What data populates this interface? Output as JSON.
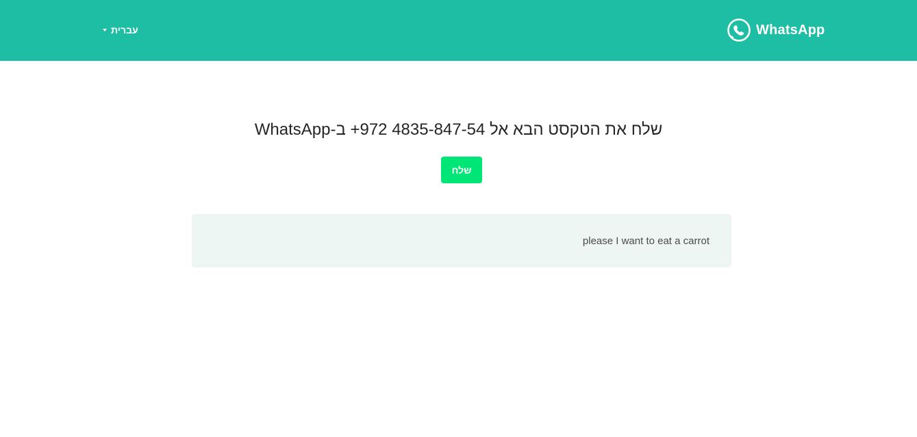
{
  "header": {
    "language_label": "עברית",
    "brand_name": "WhatsApp",
    "background_color": "#1ebea5"
  },
  "main": {
    "title": "שלח את הטקסט הבא אל 4835-847-54 972+ ב-WhatsApp",
    "send_button_label": "שלח",
    "send_button_color": "#00e676",
    "message_text": "please I want to eat a carrot"
  },
  "icons": {
    "language_caret": "caret-down-icon",
    "brand_logo": "whatsapp-logo-icon"
  }
}
